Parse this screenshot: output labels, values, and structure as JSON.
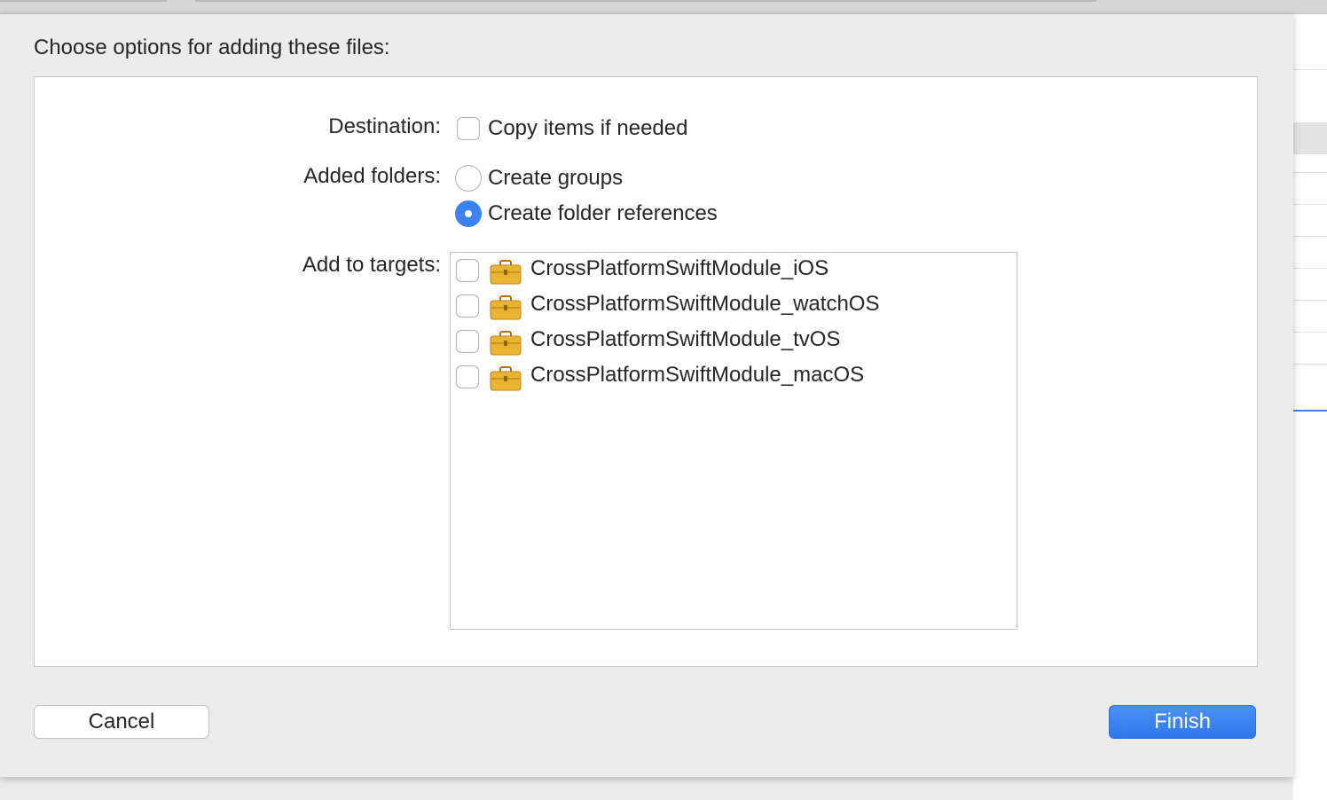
{
  "dialog": {
    "heading": "Choose options for adding these files:"
  },
  "destination": {
    "label": "Destination:",
    "copy_items": {
      "label": "Copy items if needed",
      "checked": false
    }
  },
  "added_folders": {
    "label": "Added folders:",
    "options": [
      {
        "label": "Create groups",
        "selected": false
      },
      {
        "label": "Create folder references",
        "selected": true
      }
    ]
  },
  "targets": {
    "label": "Add to targets:",
    "items": [
      {
        "name": "CrossPlatformSwiftModule_iOS",
        "icon": "briefcase-icon",
        "checked": false
      },
      {
        "name": "CrossPlatformSwiftModule_watchOS",
        "icon": "briefcase-icon",
        "checked": false
      },
      {
        "name": "CrossPlatformSwiftModule_tvOS",
        "icon": "briefcase-icon",
        "checked": false
      },
      {
        "name": "CrossPlatformSwiftModule_macOS",
        "icon": "briefcase-icon",
        "checked": false
      }
    ]
  },
  "buttons": {
    "cancel": "Cancel",
    "finish": "Finish"
  },
  "colors": {
    "accent": "#3b82f6",
    "briefcase": "#e8b432"
  }
}
